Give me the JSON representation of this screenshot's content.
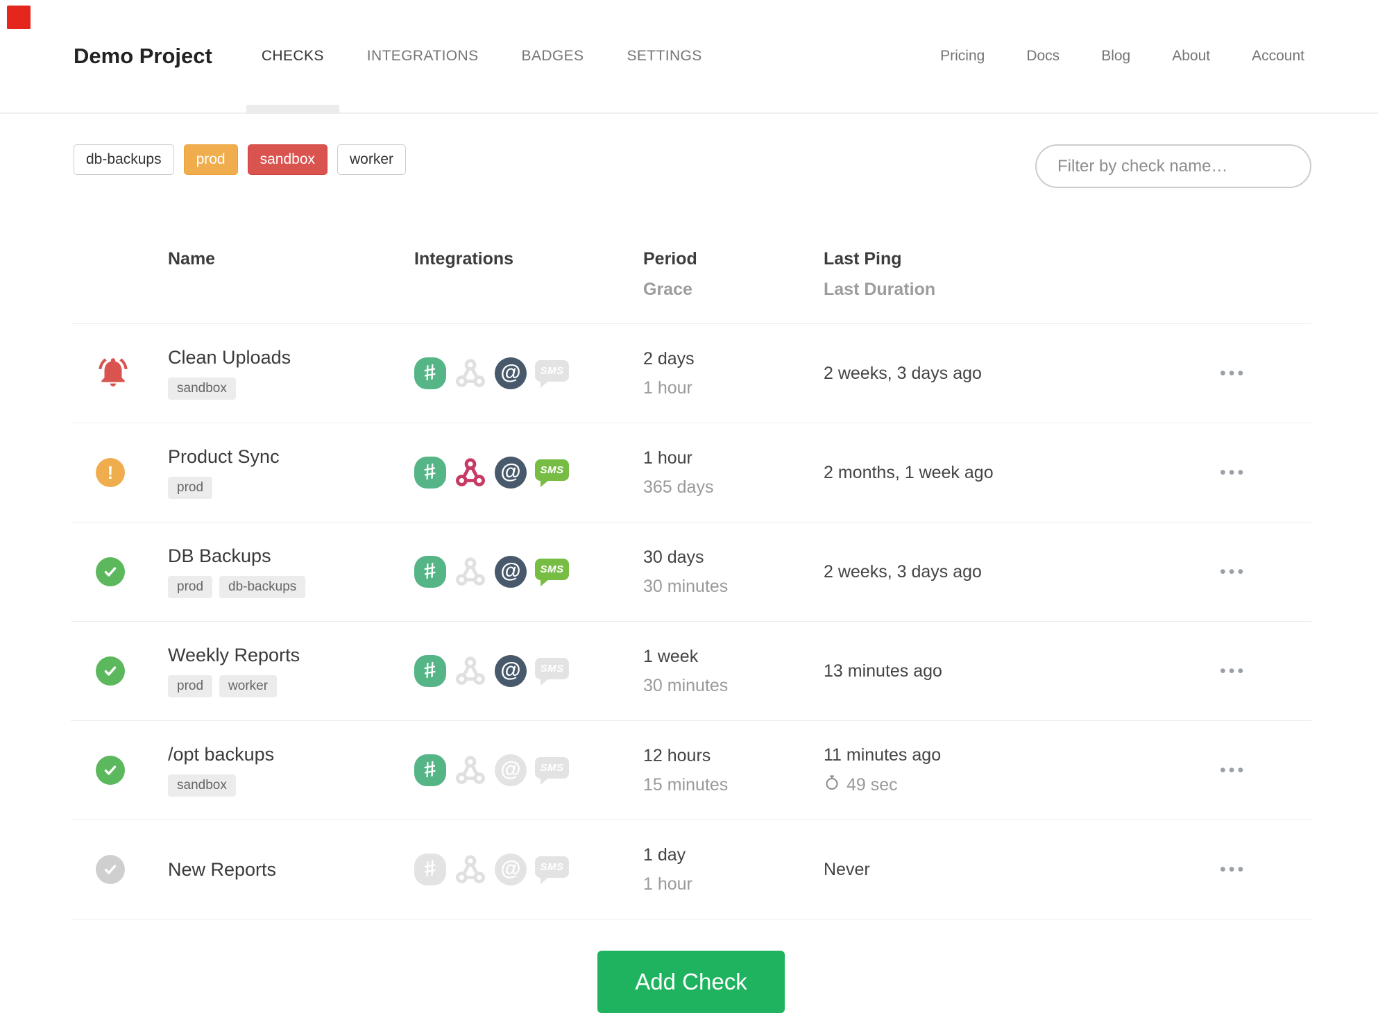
{
  "nav": {
    "project": "Demo Project",
    "tabs": [
      {
        "label": "CHECKS",
        "active": true
      },
      {
        "label": "INTEGRATIONS",
        "active": false
      },
      {
        "label": "BADGES",
        "active": false
      },
      {
        "label": "SETTINGS",
        "active": false
      }
    ],
    "links": [
      "Pricing",
      "Docs",
      "Blog",
      "About"
    ],
    "account_label": "Account"
  },
  "filters": {
    "tags": [
      {
        "label": "db-backups",
        "style": "outline"
      },
      {
        "label": "prod",
        "style": "orange"
      },
      {
        "label": "sandbox",
        "style": "red"
      },
      {
        "label": "worker",
        "style": "outline"
      }
    ],
    "search_placeholder": "Filter by check name…"
  },
  "table": {
    "headers": {
      "name": "Name",
      "integrations": "Integrations",
      "period": "Period",
      "grace": "Grace",
      "last_ping": "Last Ping",
      "last_duration": "Last Duration"
    },
    "integration_order": [
      "slack",
      "webhook",
      "email",
      "sms"
    ],
    "rows": [
      {
        "status": "alert",
        "name": "Clean Uploads",
        "tags": [
          "sandbox"
        ],
        "period": "2 days",
        "grace": "1 hour",
        "last_ping": "2 weeks, 3 days ago",
        "last_duration": null,
        "integrations": {
          "slack": true,
          "webhook": false,
          "email": true,
          "sms": false
        }
      },
      {
        "status": "warn",
        "name": "Product Sync",
        "tags": [
          "prod"
        ],
        "period": "1 hour",
        "grace": "365 days",
        "last_ping": "2 months, 1 week ago",
        "last_duration": null,
        "integrations": {
          "slack": true,
          "webhook": true,
          "email": true,
          "sms": true
        }
      },
      {
        "status": "ok",
        "name": "DB Backups",
        "tags": [
          "prod",
          "db-backups"
        ],
        "period": "30 days",
        "grace": "30 minutes",
        "last_ping": "2 weeks, 3 days ago",
        "last_duration": null,
        "integrations": {
          "slack": true,
          "webhook": false,
          "email": true,
          "sms": true
        }
      },
      {
        "status": "ok",
        "name": "Weekly Reports",
        "tags": [
          "prod",
          "worker"
        ],
        "period": "1 week",
        "grace": "30 minutes",
        "last_ping": "13 minutes ago",
        "last_duration": null,
        "integrations": {
          "slack": true,
          "webhook": false,
          "email": true,
          "sms": false
        }
      },
      {
        "status": "ok",
        "name": "/opt backups",
        "tags": [
          "sandbox"
        ],
        "period": "12 hours",
        "grace": "15 minutes",
        "last_ping": "11 minutes ago",
        "last_duration": "49 sec",
        "integrations": {
          "slack": true,
          "webhook": false,
          "email": false,
          "sms": false
        }
      },
      {
        "status": "new",
        "name": "New Reports",
        "tags": [],
        "period": "1 day",
        "grace": "1 hour",
        "last_ping": "Never",
        "last_duration": null,
        "integrations": {
          "slack": false,
          "webhook": false,
          "email": false,
          "sms": false
        }
      }
    ]
  },
  "add_check_label": "Add Check",
  "icons": {
    "menu": "•••",
    "caret": "▾",
    "slack_glyph": "#",
    "email_glyph": "@",
    "sms_glyph": "SMS",
    "warn_glyph": "!"
  },
  "colors": {
    "button_green": "#1fb35f",
    "status_ok": "#5cb85c",
    "status_warn": "#f0ad4e",
    "status_alert": "#d9534f",
    "status_new": "#cfcfcf",
    "tag_prod": "#f0ad4e",
    "tag_sandbox": "#d9534f",
    "slack_green": "#55b587",
    "webhook_crimson": "#c73a63",
    "email_navy": "#47596b",
    "sms_green": "#77bd43"
  }
}
